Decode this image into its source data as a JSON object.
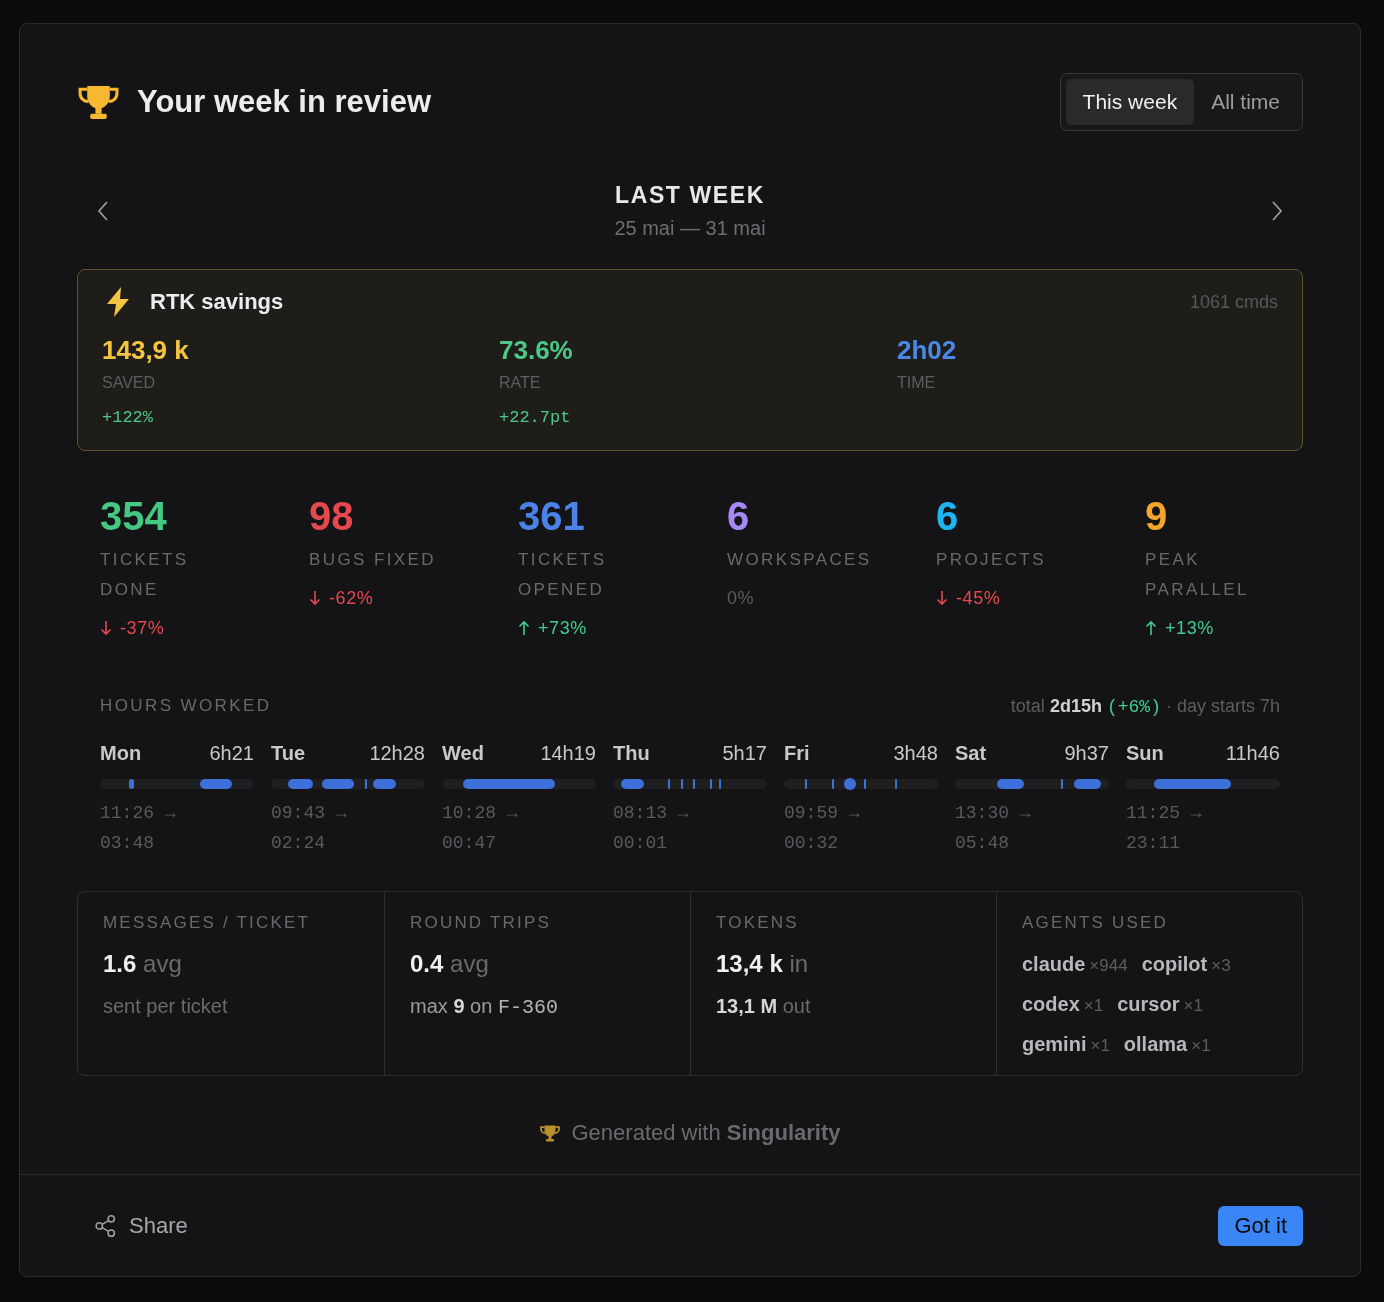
{
  "header": {
    "title": "Your week in review"
  },
  "range_tabs": [
    {
      "label": "This week",
      "selected": true
    },
    {
      "label": "All time",
      "selected": false
    }
  ],
  "week_nav": {
    "title": "LAST WEEK",
    "dates": "25 mai — 31 mai"
  },
  "rtk_savings": {
    "title": "RTK savings",
    "commands": "1061 cmds",
    "metrics": [
      {
        "value": "143,9 k",
        "label": "SAVED",
        "change": "+122%",
        "color": "#f5c443"
      },
      {
        "value": "73.6%",
        "label": "RATE",
        "change": "+22.7pt",
        "color": "#4cc987"
      },
      {
        "value": "2h02",
        "label": "TIME",
        "color": "#4a87e8"
      }
    ]
  },
  "stats": [
    {
      "value": "354",
      "label": "TICKETS DONE",
      "change": "-37%",
      "kind": "down",
      "color": "#45c982"
    },
    {
      "value": "98",
      "label": "BUGS FIXED",
      "change": "-62%",
      "kind": "down",
      "color": "#e5484d"
    },
    {
      "value": "361",
      "label": "TICKETS OPENED",
      "change": "+73%",
      "kind": "up",
      "color": "#4b82ea"
    },
    {
      "value": "6",
      "label": "WORKSPACES",
      "change": "0%",
      "kind": "flat",
      "color": "#a58af5"
    },
    {
      "value": "6",
      "label": "PROJECTS",
      "change": "-45%",
      "kind": "down",
      "color": "#1eb6f2"
    },
    {
      "value": "9",
      "label": "PEAK PARALLEL",
      "change": "+13%",
      "kind": "up",
      "color": "#f4a52c"
    }
  ],
  "hours_worked": {
    "title": "HOURS WORKED",
    "total_label": "total",
    "total": "2d15h",
    "total_change": "(+6%)",
    "day_start": "· day starts 7h",
    "days": [
      {
        "day": "Mon",
        "hours": "6h21",
        "start": "11:26 →",
        "end": "03:48"
      },
      {
        "day": "Tue",
        "hours": "12h28",
        "start": "09:43 →",
        "end": "02:24"
      },
      {
        "day": "Wed",
        "hours": "14h19",
        "start": "10:28 →",
        "end": "00:47"
      },
      {
        "day": "Thu",
        "hours": "5h17",
        "start": "08:13 →",
        "end": "00:01"
      },
      {
        "day": "Fri",
        "hours": "3h48",
        "start": "09:59 →",
        "end": "00:32"
      },
      {
        "day": "Sat",
        "hours": "9h37",
        "start": "13:30 →",
        "end": "05:48"
      },
      {
        "day": "Sun",
        "hours": "11h46",
        "start": "11:25 →",
        "end": "23:11"
      }
    ]
  },
  "summary": [
    {
      "kind": "text",
      "label": "MESSAGES / TICKET",
      "lines": [
        {
          "parts": [
            {
              "text": "1.6",
              "kind": "value"
            },
            {
              "text": "avg",
              "kind": "unit"
            }
          ]
        },
        {
          "parts": [
            {
              "text": "sent per ticket",
              "kind": "dim"
            }
          ]
        }
      ]
    },
    {
      "kind": "text",
      "label": "ROUND TRIPS",
      "lines": [
        {
          "parts": [
            {
              "text": "0.4",
              "kind": "value"
            },
            {
              "text": "avg",
              "kind": "unit"
            }
          ]
        },
        {
          "parts": [
            {
              "text": "max",
              "kind": "soft"
            },
            {
              "text": "9",
              "kind": "strong"
            },
            {
              "text": "on",
              "kind": "soft"
            },
            {
              "text": "F-360",
              "kind": "code"
            }
          ]
        }
      ]
    },
    {
      "kind": "text",
      "label": "TOKENS",
      "lines": [
        {
          "parts": [
            {
              "text": "13,4 k",
              "kind": "value"
            },
            {
              "text": "in",
              "kind": "unit"
            }
          ]
        },
        {
          "parts": [
            {
              "text": "13,1 M",
              "kind": "strong"
            },
            {
              "text": "out",
              "kind": "dim"
            }
          ]
        }
      ]
    },
    {
      "kind": "agents",
      "label": "AGENTS USED",
      "agents": [
        {
          "name": "claude",
          "count": "×944"
        },
        {
          "name": "copilot",
          "count": "×3"
        },
        {
          "name": "codex",
          "count": "×1"
        },
        {
          "name": "cursor",
          "count": "×1"
        },
        {
          "name": "gemini",
          "count": "×1"
        },
        {
          "name": "ollama",
          "count": "×1"
        }
      ]
    }
  ],
  "footer_note": "Generated with **Singularity**",
  "actions": {
    "share": "Share",
    "confirm": "Got it"
  }
}
